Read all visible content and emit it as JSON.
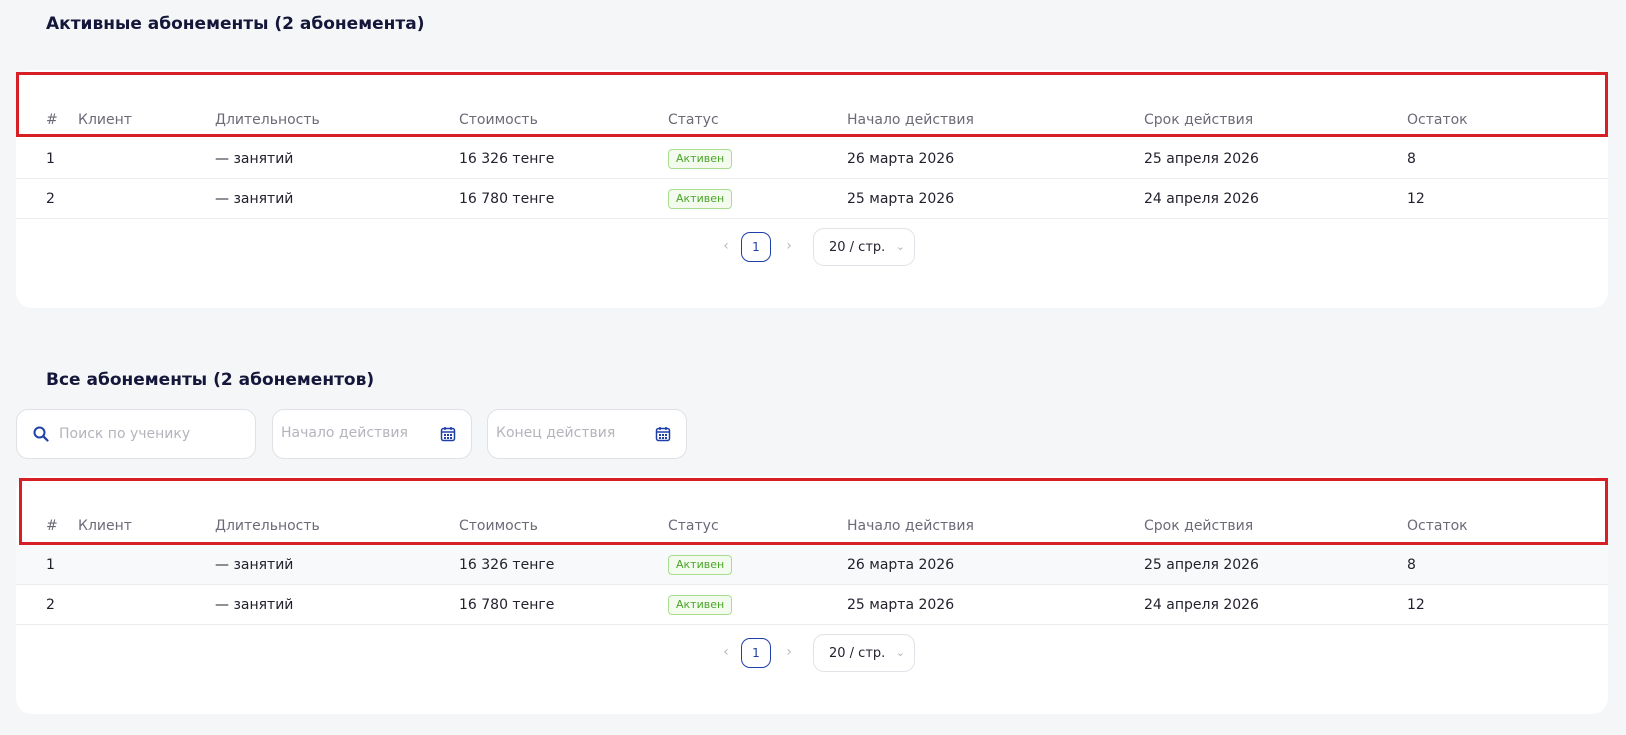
{
  "active_section": {
    "title": "Активные абонементы (2 абонемента)",
    "columns": [
      "#",
      "Клиент",
      "Длительность",
      "Стоимость",
      "Статус",
      "Начало действия",
      "Срок действия",
      "Остаток"
    ],
    "rows": [
      {
        "num": "1",
        "client": "",
        "duration": "— занятий",
        "cost": "16 326 тенге",
        "status": "Активен",
        "start": "26 марта 2026",
        "end": "25 апреля 2026",
        "remaining": "8"
      },
      {
        "num": "2",
        "client": "",
        "duration": "— занятий",
        "cost": "16 780 тенге",
        "status": "Активен",
        "start": "25 марта 2026",
        "end": "24 апреля 2026",
        "remaining": "12"
      }
    ],
    "pagination": {
      "prev": "‹",
      "page": "1",
      "next": "›",
      "page_size": "20 / стр."
    }
  },
  "all_section": {
    "title": "Все абонементы (2 абонементов)",
    "search": {
      "placeholder": "Поиск по ученику",
      "icon": "search-icon"
    },
    "start_filter": {
      "placeholder": "Начало действия",
      "icon": "calendar-icon"
    },
    "end_filter": {
      "placeholder": "Конец действия",
      "icon": "calendar-icon"
    },
    "columns": [
      "#",
      "Клиент",
      "Длительность",
      "Стоимость",
      "Статус",
      "Начало действия",
      "Срок действия",
      "Остаток"
    ],
    "rows": [
      {
        "num": "1",
        "client": "",
        "duration": "— занятий",
        "cost": "16 326 тенге",
        "status": "Активен",
        "start": "26 марта 2026",
        "end": "25 апреля 2026",
        "remaining": "8"
      },
      {
        "num": "2",
        "client": "",
        "duration": "— занятий",
        "cost": "16 780 тенге",
        "status": "Активен",
        "start": "25 марта 2026",
        "end": "24 апреля 2026",
        "remaining": "12"
      }
    ],
    "pagination": {
      "prev": "‹",
      "page": "1",
      "next": "›",
      "page_size": "20 / стр."
    }
  },
  "colors": {
    "accent": "#1f3fa8",
    "highlight_border": "#d71f26",
    "status_active": "#4aa52a"
  }
}
